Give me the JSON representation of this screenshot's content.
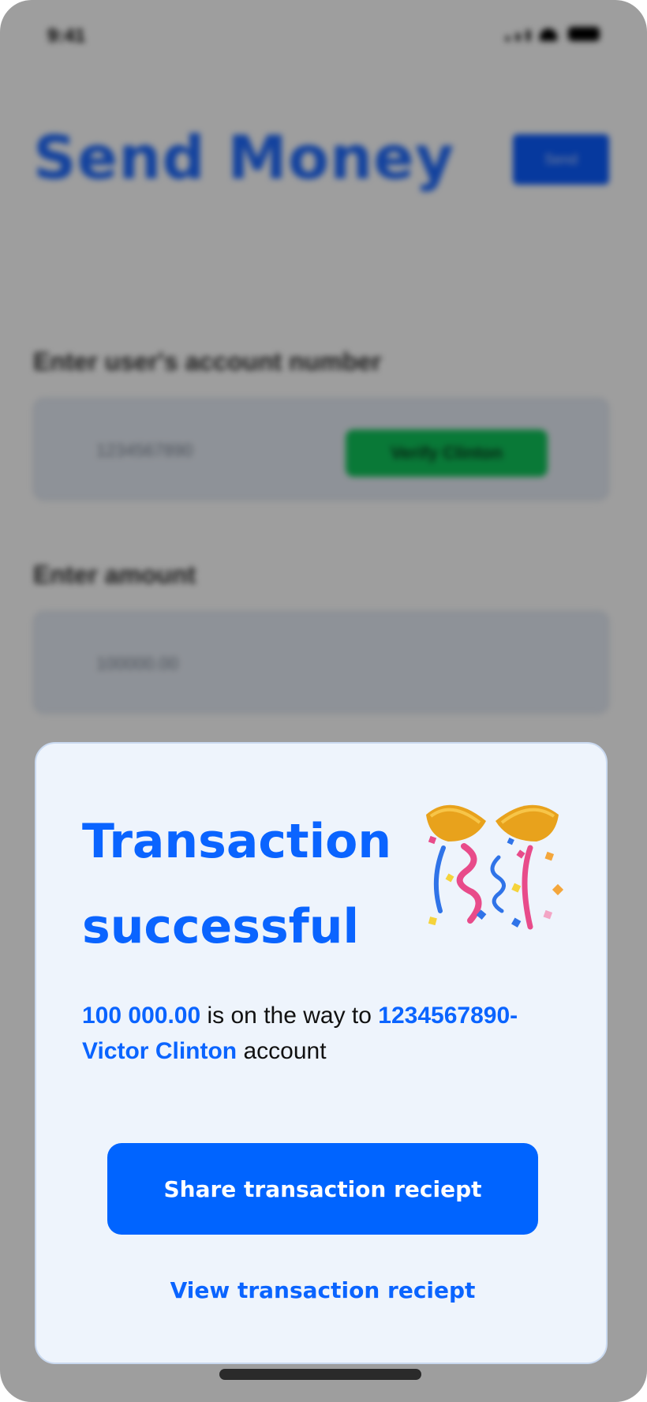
{
  "status_bar": {
    "time": "9:41"
  },
  "header": {
    "title": "Send Money",
    "action_label": "Send"
  },
  "account_field": {
    "label": "Enter user's account number",
    "value": "1234567890",
    "verify_label": "Verify Clinton"
  },
  "amount_field": {
    "label": "Enter amount",
    "value": "100000.00"
  },
  "modal": {
    "title_line1": "Transaction",
    "title_line2": "successful",
    "amount": "100 000.00",
    "text_mid": " is on the way to ",
    "account": "1234567890-Victor Clinton",
    "text_end": " account",
    "share_label": "Share transaction reciept",
    "view_label": "View transaction reciept",
    "icon": "party-popper-icon"
  },
  "colors": {
    "primary": "#0064FF",
    "verify_green": "#10C35A",
    "modal_bg": "#EEF4FC"
  }
}
